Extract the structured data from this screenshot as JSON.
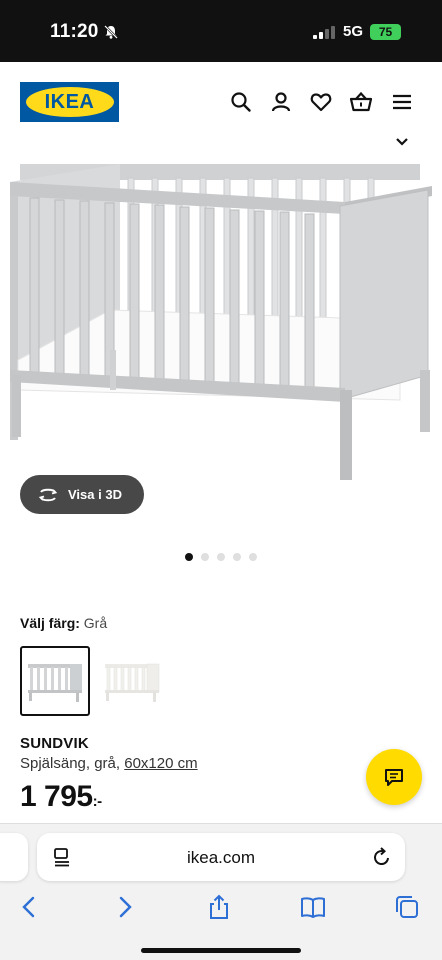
{
  "status_bar": {
    "time": "11:20",
    "network": "5G",
    "battery": "75"
  },
  "header": {
    "logo_text": "IKEA",
    "icons": [
      "search-icon",
      "user-icon",
      "heart-icon",
      "basket-icon",
      "menu-icon"
    ]
  },
  "product": {
    "view_3d_label": "Visa i 3D",
    "image_count": 5,
    "active_image": 1,
    "color_label": "Välj färg:",
    "color_value": "Grå",
    "swatches": [
      {
        "name": "Grå",
        "selected": true
      },
      {
        "name": "Vit",
        "selected": false
      }
    ],
    "name": "SUNDVIK",
    "description": "Spjälsäng, grå,",
    "size": "60x120 cm",
    "price": "1 795",
    "price_suffix": ":-"
  },
  "browser": {
    "url": "ikea.com",
    "nav": [
      "back-icon",
      "forward-icon",
      "share-icon",
      "bookmarks-icon",
      "tabs-icon"
    ]
  },
  "colors": {
    "ikea_blue": "#0058a3",
    "ikea_yellow": "#ffda1a",
    "chat_yellow": "#ffdb00",
    "crib_gray": "#d6d8da"
  }
}
